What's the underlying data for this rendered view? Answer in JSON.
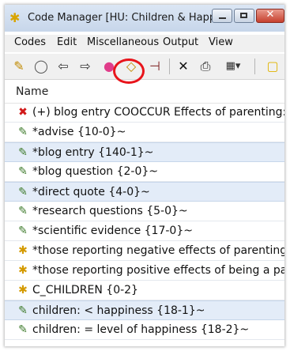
{
  "window": {
    "title": "Code Manager [HU: Children & Happ...",
    "accent": "#c7d6ea",
    "close_color": "#c6402e"
  },
  "menu": [
    "Codes",
    "Edit",
    "Miscellaneous",
    "Output",
    "View"
  ],
  "toolbar": {
    "buttons": [
      {
        "name": "new-code-icon",
        "glyph": "✎"
      },
      {
        "name": "comment-icon",
        "glyph": "◯"
      },
      {
        "name": "back-arrow-icon",
        "glyph": "⇦"
      },
      {
        "name": "forward-arrow-icon",
        "glyph": "⇨"
      },
      {
        "name": "color-wheel-icon",
        "glyph": "●"
      },
      {
        "name": "network-icon",
        "glyph": "◇"
      },
      {
        "name": "export-icon",
        "glyph": "⊣"
      },
      {
        "name": "delete-icon",
        "glyph": "✕"
      },
      {
        "name": "print-icon",
        "glyph": "⎙"
      },
      {
        "name": "view-dropdown-icon",
        "glyph": "▦▾"
      },
      {
        "name": "extra-icon",
        "glyph": "▢"
      }
    ],
    "highlight_color": "#e8141b"
  },
  "list": {
    "header": "Name",
    "rows": [
      {
        "icon": "x",
        "label": "(+) blog entry COOCCUR Effects of parenting: pc",
        "selected": false
      },
      {
        "icon": "doc",
        "label": "*advise {10-0}~",
        "selected": false
      },
      {
        "icon": "doc",
        "label": "*blog entry {140-1}~",
        "selected": true
      },
      {
        "icon": "doc",
        "label": "*blog question {2-0}~",
        "selected": false
      },
      {
        "icon": "doc",
        "label": "*direct quote {4-0}~",
        "selected": true
      },
      {
        "icon": "doc",
        "label": "*research questions {5-0}~",
        "selected": false
      },
      {
        "icon": "doc",
        "label": "*scientific evidence {17-0}~",
        "selected": false
      },
      {
        "icon": "star",
        "label": "*those reporting negative effects of parenting {",
        "selected": false
      },
      {
        "icon": "star",
        "label": "*those reporting positive effects of being a pare",
        "selected": false
      },
      {
        "icon": "star",
        "label": "C_CHILDREN {0-2}",
        "selected": false
      },
      {
        "icon": "doc",
        "label": "children: < happiness {18-1}~",
        "selected": true
      },
      {
        "icon": "doc",
        "label": "children: = level of happiness {18-2}~",
        "selected": false
      }
    ]
  }
}
